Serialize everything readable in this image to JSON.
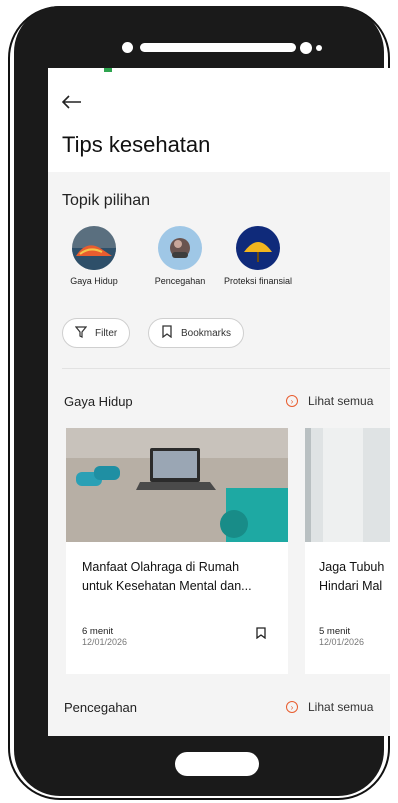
{
  "header": {
    "back_icon": "arrow-left-icon",
    "title": "Tips kesehatan"
  },
  "topics": {
    "label": "Topik pilihan",
    "items": [
      {
        "label": "Gaya Hidup"
      },
      {
        "label": "Pencegahan"
      },
      {
        "label": "Proteksi finansial"
      }
    ]
  },
  "filters": {
    "filter_label": "Filter",
    "bookmarks_label": "Bookmarks"
  },
  "gaya_hidup": {
    "title": "Gaya Hidup",
    "see_all": "Lihat semua",
    "cards": [
      {
        "title_line1": "Manfaat Olahraga di Rumah",
        "title_line2": "untuk Kesehatan Mental dan...",
        "duration": "6 menit",
        "date": "12/01/2026"
      },
      {
        "title_line1": "Jaga Tubuh",
        "title_line2": "Hindari Mal",
        "duration": "5 menit",
        "date": "12/01/2026"
      }
    ]
  },
  "pencegahan": {
    "title": "Pencegahan",
    "see_all": "Lihat semua"
  },
  "colors": {
    "accent": "#e85d2f",
    "background": "#f4f4f4",
    "frame": "#1a1a1a"
  }
}
